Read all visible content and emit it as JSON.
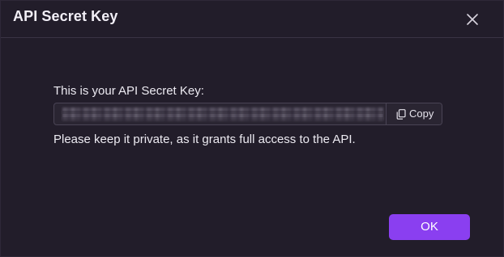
{
  "dialog": {
    "title": "API Secret Key",
    "close_icon": "close-icon",
    "intro_text": "This is your API Secret Key:",
    "key_field": {
      "value": "",
      "masked": true
    },
    "copy_button": {
      "label": "Copy",
      "icon": "copy-icon"
    },
    "note_text": "Please keep it private, as it grants full access to the API.",
    "ok_button": {
      "label": "OK"
    }
  },
  "colors": {
    "background": "#221d2a",
    "accent": "#8a3ff0",
    "text": "#eceaf1",
    "border": "#4a4455"
  }
}
